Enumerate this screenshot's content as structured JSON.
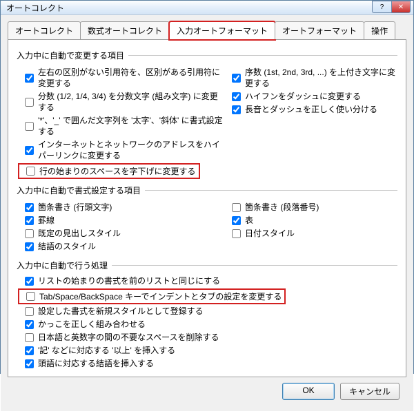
{
  "window": {
    "title": "オートコレクト"
  },
  "tabs": {
    "t1": "オートコレクト",
    "t2": "数式オートコレクト",
    "t3": "入力オートフォーマット",
    "t4": "オートフォーマット",
    "t5": "操作"
  },
  "sections": {
    "s1": "入力中に自動で変更する項目",
    "s2": "入力中に自動で書式設定する項目",
    "s3": "入力中に自動で行う処理"
  },
  "opts": {
    "a1": "左右の区別がない引用符を、区別がある引用符に変更する",
    "a2": "分数 (1/2, 1/4, 3/4) を分数文字 (組み文字) に変更する",
    "a3": "'*'、'_' で囲んだ文字列を '太字'、'斜体' に書式設定する",
    "a4": "インターネットとネットワークのアドレスをハイパーリンクに変更する",
    "a5": "行の始まりのスペースを字下げに変更する",
    "ar1": "序数 (1st, 2nd, 3rd, ...) を上付き文字に変更する",
    "ar2": "ハイフンをダッシュに変更する",
    "ar3": "長音とダッシュを正しく使い分ける",
    "b1": "箇条書き (行頭文字)",
    "b2": "罫線",
    "b3": "既定の見出しスタイル",
    "b4": "結語のスタイル",
    "br1": "箇条書き (段落番号)",
    "br2": "表",
    "br3": "日付スタイル",
    "c1": "リストの始まりの書式を前のリストと同じにする",
    "c2": "Tab/Space/BackSpace キーでインデントとタブの設定を変更する",
    "c3": "設定した書式を新規スタイルとして登録する",
    "c4": "かっこを正しく組み合わせる",
    "c5": "日本語と英数字の間の不要なスペースを削除する",
    "c6": "'記' などに対応する '以上' を挿入する",
    "c7": "頭語に対応する結語を挿入する"
  },
  "buttons": {
    "ok": "OK",
    "cancel": "キャンセル"
  }
}
